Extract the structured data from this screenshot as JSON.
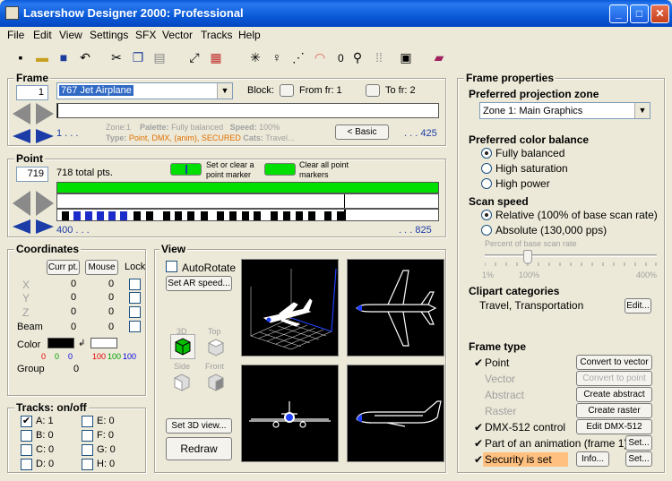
{
  "window": {
    "title": "Lasershow Designer 2000: Professional"
  },
  "menu": [
    "File",
    "Edit",
    "View",
    "Settings",
    "SFX",
    "Vector",
    "Tracks",
    "Help"
  ],
  "toolbar": {
    "counter": "0"
  },
  "frame": {
    "title": "Frame",
    "number": "1",
    "name": "767 Jet Airplane",
    "block_label": "Block:",
    "from_label": "From fr: 1",
    "to_label": "To fr: 2",
    "zone_label": "Zone:",
    "zone_val": "1",
    "palette_label": "Palette:",
    "palette_val": "Fully balanced",
    "speed_label": "Speed:",
    "speed_val": "100%",
    "type_label": "Type:",
    "type_val": "Point, DMX, (anim), SECURED",
    "cats_label": "Cats:",
    "cats_val": "Travel...",
    "basic_btn": "< Basic",
    "range_start": "1 . . .",
    "range_end": ". . . 425"
  },
  "point": {
    "title": "Point",
    "number": "719",
    "total": "718 total pts.",
    "set_clear": "Set or clear a point marker",
    "clear_all": "Clear all point markers",
    "range_start": "400 . . .",
    "range_end": ". . . 825"
  },
  "coords": {
    "title": "Coordinates",
    "curr_btn": "Curr pt.",
    "mouse_btn": "Mouse",
    "lock": "Lock",
    "rows": [
      {
        "l": "X",
        "a": "0",
        "b": "0"
      },
      {
        "l": "Y",
        "a": "0",
        "b": "0"
      },
      {
        "l": "Z",
        "a": "0",
        "b": "0"
      },
      {
        "l": "Beam",
        "a": "0",
        "b": "0"
      }
    ],
    "color_label": "Color",
    "rgb1": [
      "0",
      "0",
      "0"
    ],
    "rgb2": [
      "100",
      "100",
      "100"
    ],
    "group_label": "Group",
    "group_val": "0"
  },
  "tracks": {
    "title": "Tracks: on/off",
    "items": [
      {
        "t": "A: 1",
        "on": true
      },
      {
        "t": "E: 0",
        "on": false
      },
      {
        "t": "B: 0",
        "on": false
      },
      {
        "t": "F: 0",
        "on": false
      },
      {
        "t": "C: 0",
        "on": false
      },
      {
        "t": "G: 0",
        "on": false
      },
      {
        "t": "D: 0",
        "on": false
      },
      {
        "t": "H: 0",
        "on": false
      }
    ]
  },
  "view": {
    "title": "View",
    "autorotate": "AutoRotate",
    "set_ar": "Set AR speed...",
    "v3d": "3D",
    "top": "Top",
    "side": "Side",
    "front": "Front",
    "set3d": "Set 3D view...",
    "redraw": "Redraw"
  },
  "props": {
    "title": "Frame properties",
    "zone_head": "Preferred projection zone",
    "zone_val": "Zone 1: Main Graphics",
    "color_head": "Preferred color balance",
    "color_opts": [
      "Fully balanced",
      "High saturation",
      "High power"
    ],
    "scan_head": "Scan speed",
    "scan_opts": [
      "Relative (100% of base scan rate)",
      "Absolute (130,000 pps)"
    ],
    "slider_label": "Percent of base scan rate",
    "slider_ticks": [
      "1%",
      "100%",
      "400%"
    ],
    "slider_value_pct": 100,
    "clip_head": "Clipart categories",
    "clip_val": "Travel, Transportation",
    "edit_btn": "Edit...",
    "type_head": "Frame type",
    "types": [
      {
        "t": "Point",
        "check": true,
        "btn": "Convert to vector",
        "dis": false,
        "btn_dis": false
      },
      {
        "t": "Vector",
        "check": false,
        "btn": "Convert to point",
        "dis": true,
        "btn_dis": true
      },
      {
        "t": "Abstract",
        "check": false,
        "btn": "Create abstract",
        "dis": true,
        "btn_dis": false
      },
      {
        "t": "Raster",
        "check": false,
        "btn": "Create raster",
        "dis": true,
        "btn_dis": false
      },
      {
        "t": "DMX-512 control",
        "check": true,
        "btn": "Edit DMX-512",
        "dis": false,
        "btn_dis": false
      },
      {
        "t": "Part of an animation (frame 1)",
        "check": true,
        "btn": "Set...",
        "dis": false,
        "btn_dis": false
      },
      {
        "t": "Security is set",
        "check": true,
        "btn": "Set...",
        "dis": false,
        "btn_dis": false
      }
    ],
    "info_btn": "Info..."
  }
}
